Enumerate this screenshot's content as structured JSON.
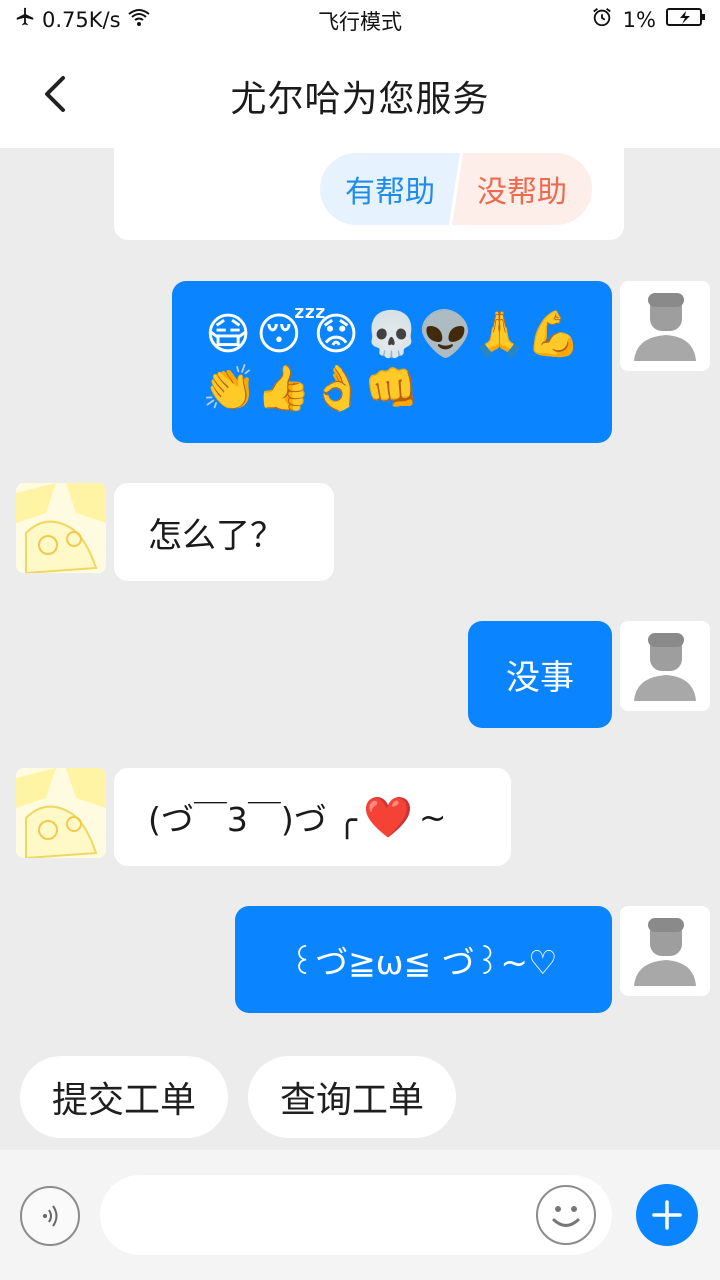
{
  "status_bar": {
    "speed": "0.75K/s",
    "mode": "飞行模式",
    "battery": "1%"
  },
  "header": {
    "title": "尤尔哈为您服务"
  },
  "feedback": {
    "yes_label": "有帮助",
    "no_label": "没帮助"
  },
  "messages": [
    {
      "from": "user",
      "type": "emoji",
      "emojis": [
        "😷",
        "😴",
        "😟",
        "💀",
        "👽",
        "🙏",
        "💪",
        "👏",
        "👍",
        "👌",
        "👊"
      ]
    },
    {
      "from": "bot",
      "text": "怎么了？"
    },
    {
      "from": "user",
      "text": "没事"
    },
    {
      "from": "bot",
      "text_prefix": "(づ￣3￣)づ ╭",
      "heart": "❤️",
      "text_suffix": "~"
    },
    {
      "from": "user",
      "text": "꒰づ≧ω≦ づ꒱~♡"
    }
  ],
  "quick_replies": [
    "提交工单",
    "查询工单"
  ],
  "input": {
    "placeholder": ""
  },
  "colors": {
    "accent": "#0a84ff",
    "background": "#ececec",
    "helpful_text": "#1f8cec",
    "not_helpful_text": "#ee6a4d"
  },
  "icons": {
    "back": "chevron-left-icon",
    "voice": "voice-icon",
    "emoji": "smiley-icon",
    "plus": "plus-icon"
  }
}
